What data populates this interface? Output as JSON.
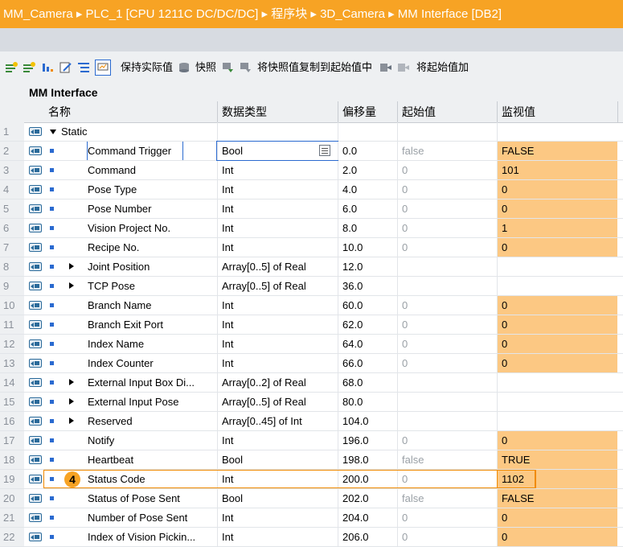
{
  "breadcrumb": "MM_Camera  ▸  PLC_1 [CPU 1211C DC/DC/DC]  ▸  程序块  ▸  3D_Camera  ▸  MM Interface [DB2]",
  "toolbar": {
    "keep_actual": "保持实际值",
    "snapshot": "快照",
    "copy_snapshot": "将快照值复制到起始值中",
    "copy_start": "将起始值加"
  },
  "block_name": "MM Interface",
  "columns": {
    "name": "名称",
    "datatype": "数据类型",
    "offset": "偏移量",
    "start": "起始值",
    "monitor": "监视值"
  },
  "rows": [
    {
      "num": "1",
      "name": "Static",
      "type": "",
      "offset": "",
      "start": "",
      "monitor": ""
    },
    {
      "num": "2",
      "name": "Command Trigger",
      "type": "Bool",
      "offset": "0.0",
      "start": "false",
      "monitor": "FALSE"
    },
    {
      "num": "3",
      "name": "Command",
      "type": "Int",
      "offset": "2.0",
      "start": "0",
      "monitor": "101"
    },
    {
      "num": "4",
      "name": "Pose Type",
      "type": "Int",
      "offset": "4.0",
      "start": "0",
      "monitor": "0"
    },
    {
      "num": "5",
      "name": "Pose Number",
      "type": "Int",
      "offset": "6.0",
      "start": "0",
      "monitor": "0"
    },
    {
      "num": "6",
      "name": "Vision Project No.",
      "type": "Int",
      "offset": "8.0",
      "start": "0",
      "monitor": "1"
    },
    {
      "num": "7",
      "name": "Recipe No.",
      "type": "Int",
      "offset": "10.0",
      "start": "0",
      "monitor": "0"
    },
    {
      "num": "8",
      "name": "Joint Position",
      "type": "Array[0..5] of Real",
      "offset": "12.0",
      "start": "",
      "monitor": ""
    },
    {
      "num": "9",
      "name": "TCP Pose",
      "type": "Array[0..5] of Real",
      "offset": "36.0",
      "start": "",
      "monitor": ""
    },
    {
      "num": "10",
      "name": "Branch Name",
      "type": "Int",
      "offset": "60.0",
      "start": "0",
      "monitor": "0"
    },
    {
      "num": "11",
      "name": "Branch Exit Port",
      "type": "Int",
      "offset": "62.0",
      "start": "0",
      "monitor": "0"
    },
    {
      "num": "12",
      "name": "Index Name",
      "type": "Int",
      "offset": "64.0",
      "start": "0",
      "monitor": "0"
    },
    {
      "num": "13",
      "name": "Index Counter",
      "type": "Int",
      "offset": "66.0",
      "start": "0",
      "monitor": "0"
    },
    {
      "num": "14",
      "name": "External Input Box Di...",
      "type": "Array[0..2] of Real",
      "offset": "68.0",
      "start": "",
      "monitor": ""
    },
    {
      "num": "15",
      "name": "External Input Pose",
      "type": "Array[0..5] of Real",
      "offset": "80.0",
      "start": "",
      "monitor": ""
    },
    {
      "num": "16",
      "name": "Reserved",
      "type": "Array[0..45] of Int",
      "offset": "104.0",
      "start": "",
      "monitor": ""
    },
    {
      "num": "17",
      "name": "Notify",
      "type": "Int",
      "offset": "196.0",
      "start": "0",
      "monitor": "0"
    },
    {
      "num": "18",
      "name": "Heartbeat",
      "type": "Bool",
      "offset": "198.0",
      "start": "false",
      "monitor": "TRUE"
    },
    {
      "num": "19",
      "name": "Status Code",
      "type": "Int",
      "offset": "200.0",
      "start": "0",
      "monitor": "1102"
    },
    {
      "num": "20",
      "name": "Status of Pose Sent",
      "type": "Bool",
      "offset": "202.0",
      "start": "false",
      "monitor": "FALSE"
    },
    {
      "num": "21",
      "name": "Number of Pose Sent",
      "type": "Int",
      "offset": "204.0",
      "start": "0",
      "monitor": "0"
    },
    {
      "num": "22",
      "name": "Index of Vision Pickin...",
      "type": "Int",
      "offset": "206.0",
      "start": "0",
      "monitor": "0"
    }
  ],
  "callout_badge": "4",
  "colors": {
    "title_bar": "#f7a324",
    "monitor_fill": "#fcc883",
    "highlight": "#f08a00"
  }
}
